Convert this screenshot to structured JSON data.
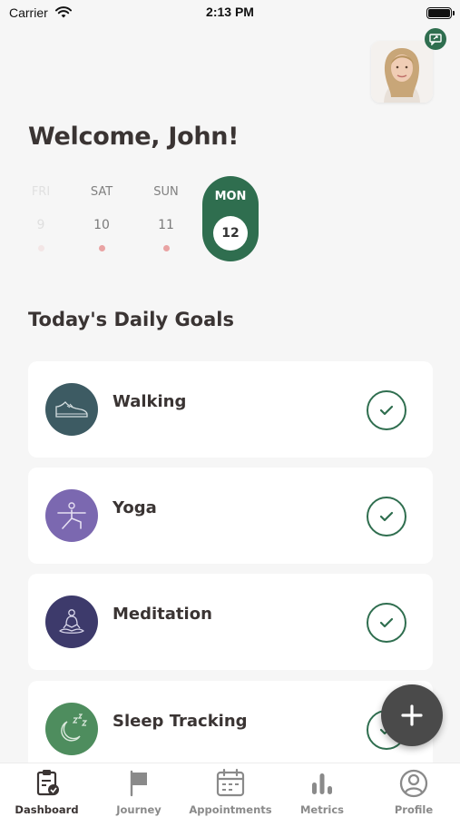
{
  "status_bar": {
    "carrier": "Carrier",
    "time": "2:13 PM"
  },
  "header": {
    "welcome": "Welcome, John!",
    "avatar_icon": "user-avatar",
    "badge_icon": "chat-icon"
  },
  "calendar": {
    "days": [
      {
        "dow": "FRI",
        "num": "9",
        "has_dot": true,
        "state": "faded"
      },
      {
        "dow": "SAT",
        "num": "10",
        "has_dot": true,
        "state": "normal"
      },
      {
        "dow": "SUN",
        "num": "11",
        "has_dot": true,
        "state": "normal"
      },
      {
        "dow": "MON",
        "num": "12",
        "has_dot": false,
        "state": "selected"
      }
    ]
  },
  "goals_section": {
    "title": "Today's Daily Goals",
    "items": [
      {
        "label": "Walking",
        "icon": "shoe-icon",
        "color": "#3d5b63",
        "done": true
      },
      {
        "label": "Yoga",
        "icon": "yoga-icon",
        "color": "#7b68b0",
        "done": true
      },
      {
        "label": "Meditation",
        "icon": "meditation-icon",
        "color": "#3d3a6b",
        "done": true
      },
      {
        "label": "Sleep Tracking",
        "icon": "moon-sleep-icon",
        "color": "#4e8d5e",
        "done": true
      }
    ]
  },
  "fab": {
    "icon": "plus-icon"
  },
  "tabs": [
    {
      "label": "Dashboard",
      "icon": "clipboard-icon",
      "active": true
    },
    {
      "label": "Journey",
      "icon": "flag-icon",
      "active": false
    },
    {
      "label": "Appointments",
      "icon": "calendar-icon",
      "active": false
    },
    {
      "label": "Metrics",
      "icon": "bar-chart-icon",
      "active": false
    },
    {
      "label": "Profile",
      "icon": "user-circle-icon",
      "active": false
    }
  ],
  "colors": {
    "accent": "#2f6e4f",
    "text": "#3a3433",
    "background": "#f6f6f6",
    "dot": "#e9a3a3"
  }
}
